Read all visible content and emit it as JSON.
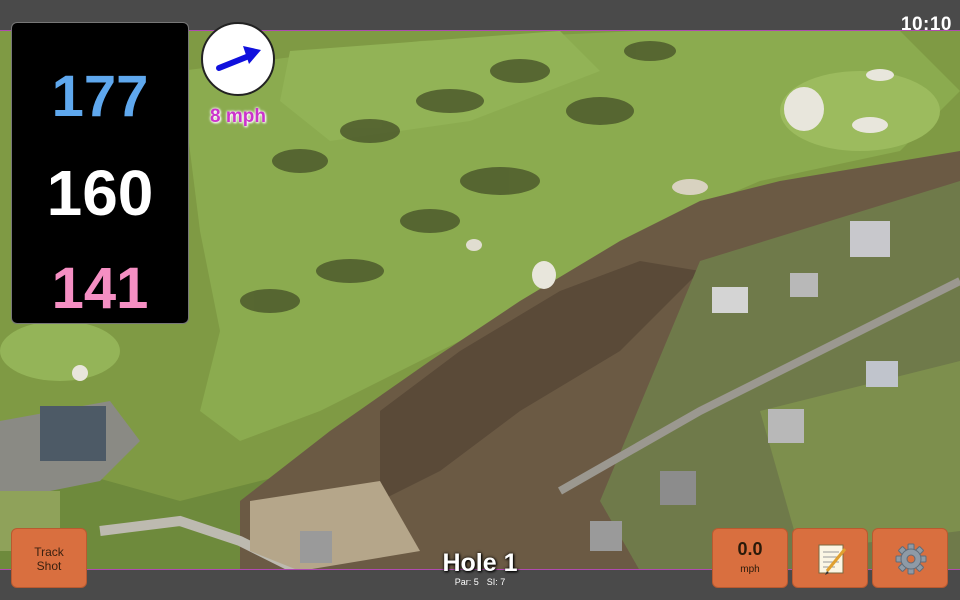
{
  "status": {
    "time": "10:10"
  },
  "distances": {
    "back": "177",
    "middle": "160",
    "front": "141"
  },
  "wind": {
    "speed_label": "8 mph",
    "direction_icon": "arrow-right-icon"
  },
  "hole": {
    "title": "Hole 1",
    "par_label": "Par: 5",
    "si_label": "SI: 7"
  },
  "buttons": {
    "track_shot_line1": "Track",
    "track_shot_line2": "Shot",
    "speed_value": "0.0",
    "speed_unit": "mph",
    "notes_icon": "notepad-icon",
    "settings_icon": "gear-icon"
  },
  "colors": {
    "back_distance": "#5fa8ee",
    "middle_distance": "#ffffff",
    "front_distance": "#f58fc3",
    "wind_text": "#cc33cc",
    "button_bg": "#d96f3f",
    "wind_arrow": "#1010dd"
  }
}
